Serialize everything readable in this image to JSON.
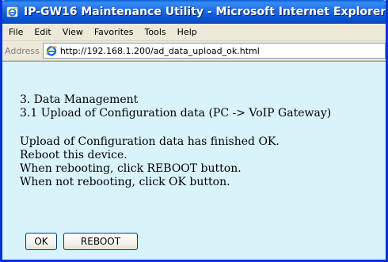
{
  "window": {
    "title": "IP-GW16 Maintenance Utility - Microsoft Internet Explorer"
  },
  "menu": {
    "items": [
      "File",
      "Edit",
      "View",
      "Favorites",
      "Tools",
      "Help"
    ]
  },
  "address": {
    "label": "Address",
    "url": "http://192.168.1.200/ad_data_upload_ok.html"
  },
  "content": {
    "heading1": "3. Data Management",
    "heading2": "3.1 Upload of Configuration data (PC -> VoIP Gateway)",
    "messages": [
      "Upload of Configuration data has finished OK.",
      "Reboot this device.",
      "When rebooting, click REBOOT button.",
      "When not rebooting, click OK button."
    ],
    "ok_label": "OK",
    "reboot_label": "REBOOT"
  },
  "colors": {
    "titlebar": "#0a5fd8",
    "content_background": "#d9f3fb",
    "chrome": "#ece9d8"
  }
}
